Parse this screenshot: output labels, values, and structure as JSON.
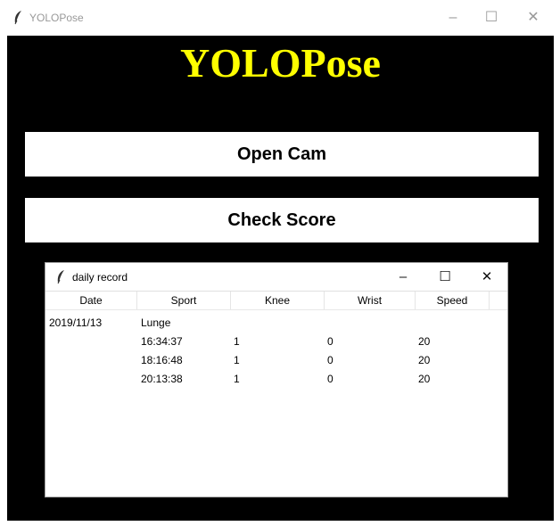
{
  "window": {
    "title": "YOLOPose",
    "minimize_glyph": "–",
    "maximize_glyph": "☐",
    "close_glyph": "✕"
  },
  "app": {
    "heading": "YOLOPose",
    "heading_color": "#ffff00",
    "background": "#000000",
    "open_cam_label": "Open Cam",
    "check_score_label": "Check Score"
  },
  "record_window": {
    "title": "daily record",
    "minimize_glyph": "–",
    "maximize_glyph": "☐",
    "close_glyph": "✕",
    "columns": [
      "Date",
      "Sport",
      "Knee",
      "Wrist",
      "Speed"
    ],
    "rows": [
      {
        "date": "2019/11/13",
        "sport": "Lunge",
        "knee": "",
        "wrist": "",
        "speed": ""
      },
      {
        "date": "",
        "sport": "16:34:37",
        "knee": "1",
        "wrist": "0",
        "speed": "20"
      },
      {
        "date": "",
        "sport": "18:16:48",
        "knee": "1",
        "wrist": "0",
        "speed": "20"
      },
      {
        "date": "",
        "sport": "20:13:38",
        "knee": "1",
        "wrist": "0",
        "speed": "20"
      }
    ]
  }
}
